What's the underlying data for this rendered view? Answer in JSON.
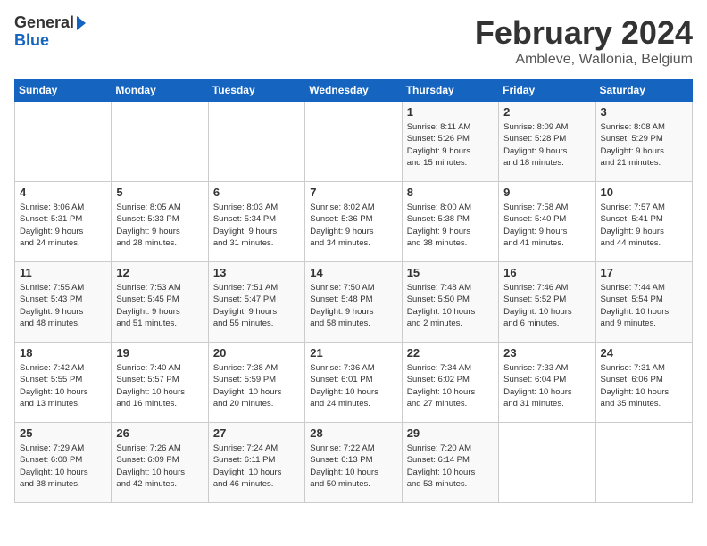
{
  "logo": {
    "line1": "General",
    "line2": "Blue"
  },
  "title": "February 2024",
  "subtitle": "Ambleve, Wallonia, Belgium",
  "days_of_week": [
    "Sunday",
    "Monday",
    "Tuesday",
    "Wednesday",
    "Thursday",
    "Friday",
    "Saturday"
  ],
  "weeks": [
    [
      {
        "num": "",
        "info": ""
      },
      {
        "num": "",
        "info": ""
      },
      {
        "num": "",
        "info": ""
      },
      {
        "num": "",
        "info": ""
      },
      {
        "num": "1",
        "info": "Sunrise: 8:11 AM\nSunset: 5:26 PM\nDaylight: 9 hours\nand 15 minutes."
      },
      {
        "num": "2",
        "info": "Sunrise: 8:09 AM\nSunset: 5:28 PM\nDaylight: 9 hours\nand 18 minutes."
      },
      {
        "num": "3",
        "info": "Sunrise: 8:08 AM\nSunset: 5:29 PM\nDaylight: 9 hours\nand 21 minutes."
      }
    ],
    [
      {
        "num": "4",
        "info": "Sunrise: 8:06 AM\nSunset: 5:31 PM\nDaylight: 9 hours\nand 24 minutes."
      },
      {
        "num": "5",
        "info": "Sunrise: 8:05 AM\nSunset: 5:33 PM\nDaylight: 9 hours\nand 28 minutes."
      },
      {
        "num": "6",
        "info": "Sunrise: 8:03 AM\nSunset: 5:34 PM\nDaylight: 9 hours\nand 31 minutes."
      },
      {
        "num": "7",
        "info": "Sunrise: 8:02 AM\nSunset: 5:36 PM\nDaylight: 9 hours\nand 34 minutes."
      },
      {
        "num": "8",
        "info": "Sunrise: 8:00 AM\nSunset: 5:38 PM\nDaylight: 9 hours\nand 38 minutes."
      },
      {
        "num": "9",
        "info": "Sunrise: 7:58 AM\nSunset: 5:40 PM\nDaylight: 9 hours\nand 41 minutes."
      },
      {
        "num": "10",
        "info": "Sunrise: 7:57 AM\nSunset: 5:41 PM\nDaylight: 9 hours\nand 44 minutes."
      }
    ],
    [
      {
        "num": "11",
        "info": "Sunrise: 7:55 AM\nSunset: 5:43 PM\nDaylight: 9 hours\nand 48 minutes."
      },
      {
        "num": "12",
        "info": "Sunrise: 7:53 AM\nSunset: 5:45 PM\nDaylight: 9 hours\nand 51 minutes."
      },
      {
        "num": "13",
        "info": "Sunrise: 7:51 AM\nSunset: 5:47 PM\nDaylight: 9 hours\nand 55 minutes."
      },
      {
        "num": "14",
        "info": "Sunrise: 7:50 AM\nSunset: 5:48 PM\nDaylight: 9 hours\nand 58 minutes."
      },
      {
        "num": "15",
        "info": "Sunrise: 7:48 AM\nSunset: 5:50 PM\nDaylight: 10 hours\nand 2 minutes."
      },
      {
        "num": "16",
        "info": "Sunrise: 7:46 AM\nSunset: 5:52 PM\nDaylight: 10 hours\nand 6 minutes."
      },
      {
        "num": "17",
        "info": "Sunrise: 7:44 AM\nSunset: 5:54 PM\nDaylight: 10 hours\nand 9 minutes."
      }
    ],
    [
      {
        "num": "18",
        "info": "Sunrise: 7:42 AM\nSunset: 5:55 PM\nDaylight: 10 hours\nand 13 minutes."
      },
      {
        "num": "19",
        "info": "Sunrise: 7:40 AM\nSunset: 5:57 PM\nDaylight: 10 hours\nand 16 minutes."
      },
      {
        "num": "20",
        "info": "Sunrise: 7:38 AM\nSunset: 5:59 PM\nDaylight: 10 hours\nand 20 minutes."
      },
      {
        "num": "21",
        "info": "Sunrise: 7:36 AM\nSunset: 6:01 PM\nDaylight: 10 hours\nand 24 minutes."
      },
      {
        "num": "22",
        "info": "Sunrise: 7:34 AM\nSunset: 6:02 PM\nDaylight: 10 hours\nand 27 minutes."
      },
      {
        "num": "23",
        "info": "Sunrise: 7:33 AM\nSunset: 6:04 PM\nDaylight: 10 hours\nand 31 minutes."
      },
      {
        "num": "24",
        "info": "Sunrise: 7:31 AM\nSunset: 6:06 PM\nDaylight: 10 hours\nand 35 minutes."
      }
    ],
    [
      {
        "num": "25",
        "info": "Sunrise: 7:29 AM\nSunset: 6:08 PM\nDaylight: 10 hours\nand 38 minutes."
      },
      {
        "num": "26",
        "info": "Sunrise: 7:26 AM\nSunset: 6:09 PM\nDaylight: 10 hours\nand 42 minutes."
      },
      {
        "num": "27",
        "info": "Sunrise: 7:24 AM\nSunset: 6:11 PM\nDaylight: 10 hours\nand 46 minutes."
      },
      {
        "num": "28",
        "info": "Sunrise: 7:22 AM\nSunset: 6:13 PM\nDaylight: 10 hours\nand 50 minutes."
      },
      {
        "num": "29",
        "info": "Sunrise: 7:20 AM\nSunset: 6:14 PM\nDaylight: 10 hours\nand 53 minutes."
      },
      {
        "num": "",
        "info": ""
      },
      {
        "num": "",
        "info": ""
      }
    ]
  ]
}
